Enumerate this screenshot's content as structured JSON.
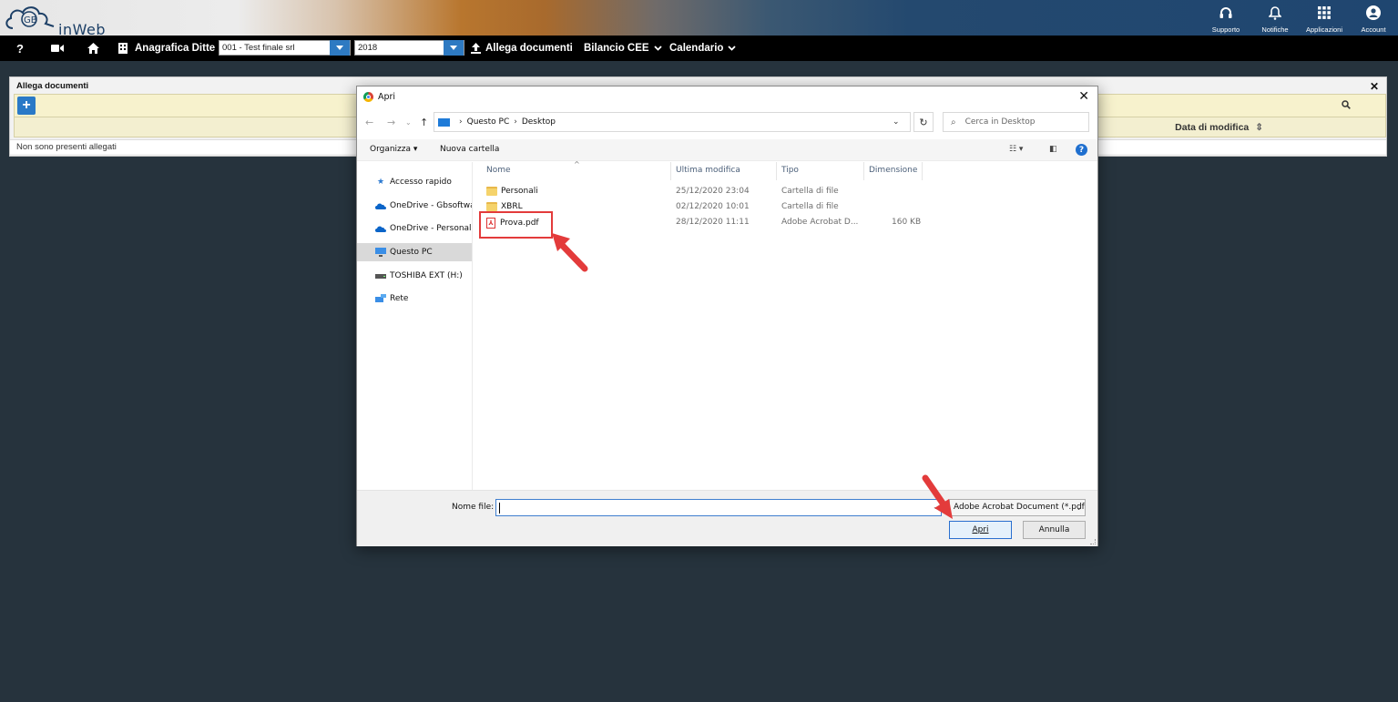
{
  "app": {
    "logo_text": "inWeb",
    "brand_mark": "GB",
    "top_icons": [
      {
        "name": "supporto-icon",
        "label": "Supporto"
      },
      {
        "name": "notifiche-icon",
        "label": "Notifiche"
      },
      {
        "name": "applicazioni-icon",
        "label": "Applicazioni"
      },
      {
        "name": "account-icon",
        "label": "Account"
      }
    ]
  },
  "menubar": {
    "help": "?",
    "anagrafica_label": "Anagrafica Ditte",
    "company_select": "001 - Test finale srl",
    "year_select": "2018",
    "allega_label": "Allega documenti",
    "bilancio_label": "Bilancio CEE",
    "calendario_label": "Calendario"
  },
  "panel": {
    "title": "Allega documenti",
    "add_label": "+",
    "column_data_modifica": "Data di modifica",
    "empty_text": "Non sono presenti allegati"
  },
  "dialog": {
    "title": "Apri",
    "path": [
      "Questo PC",
      "Desktop"
    ],
    "search_placeholder": "Cerca in Desktop",
    "organizza": "Organizza",
    "nuova_cartella": "Nuova cartella",
    "nav_items": [
      {
        "label": "Accesso rapido",
        "icon": "star-icon"
      },
      {
        "label": "OneDrive - Gbsoftware",
        "icon": "cloud-icon"
      },
      {
        "label": "OneDrive - Personal",
        "icon": "cloud-icon"
      },
      {
        "label": "Questo PC",
        "icon": "computer-icon"
      },
      {
        "label": "TOSHIBA EXT (H:)",
        "icon": "drive-icon"
      },
      {
        "label": "Rete",
        "icon": "network-icon"
      }
    ],
    "columns": {
      "name": "Nome",
      "modified": "Ultima modifica",
      "type": "Tipo",
      "size": "Dimensione"
    },
    "files": [
      {
        "name": "Personali",
        "modified": "25/12/2020 23:04",
        "type": "Cartella di file",
        "size": "",
        "kind": "folder"
      },
      {
        "name": "XBRL",
        "modified": "02/12/2020 10:01",
        "type": "Cartella di file",
        "size": "",
        "kind": "folder"
      },
      {
        "name": "Prova.pdf",
        "modified": "28/12/2020 11:11",
        "type": "Adobe Acrobat D...",
        "size": "160 KB",
        "kind": "pdf"
      }
    ],
    "file_name_label": "Nome file:",
    "file_name_value": "",
    "file_type": "Adobe Acrobat Document (*.pdf)",
    "open_button": "Apri",
    "cancel_button": "Annulla"
  },
  "colors": {
    "menu_bg": "#000000",
    "accent_blue": "#2979c7",
    "page_bg": "#26333d",
    "annotation_red": "#e33b3b"
  }
}
